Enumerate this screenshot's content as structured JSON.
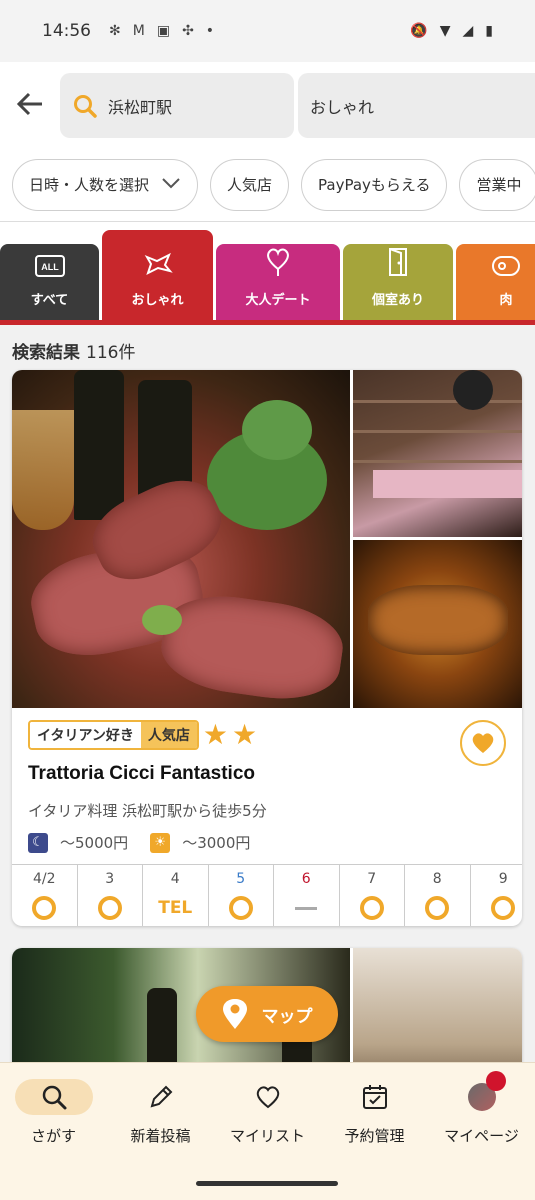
{
  "status_bar": {
    "time": "14:56",
    "dot": "•"
  },
  "search": {
    "area": "浜松町駅",
    "keyword": "おしゃれ"
  },
  "filters": [
    {
      "label": "日時・人数を選択",
      "has_chevron": true
    },
    {
      "label": "人気店"
    },
    {
      "label": "PayPayもらえる"
    },
    {
      "label": "営業中"
    }
  ],
  "tabs": [
    {
      "label": "すべて",
      "icon": "all-icon",
      "color": "#3a3a3a"
    },
    {
      "label": "おしゃれ",
      "icon": "ribbon-icon",
      "color": "#c8272c",
      "active": true
    },
    {
      "label": "大人デート",
      "icon": "heart-balloon-icon",
      "color": "#c72c7f"
    },
    {
      "label": "個室あり",
      "icon": "door-icon",
      "color": "#a5a43b"
    },
    {
      "label": "肉",
      "icon": "meat-icon",
      "color": "#e9782a"
    }
  ],
  "results": {
    "label": "検索結果",
    "count": "116件"
  },
  "card": {
    "badges": [
      "イタリアン好き",
      "人気店"
    ],
    "stars": 2,
    "name": "Trattoria Cicci Fantastico",
    "subtitle": "イタリア料理 浜松町駅から徒歩5分",
    "dinner_price": "～5000円",
    "lunch_price": "～3000円",
    "calendar": [
      {
        "date": "4/2",
        "status": "circle",
        "color": "#555"
      },
      {
        "date": "3",
        "status": "circle",
        "color": "#555"
      },
      {
        "date": "4",
        "status": "TEL",
        "color": "#555"
      },
      {
        "date": "5",
        "status": "circle",
        "color": "#3a7bc8"
      },
      {
        "date": "6",
        "status": "dash",
        "color": "#c0142c"
      },
      {
        "date": "7",
        "status": "circle",
        "color": "#555"
      },
      {
        "date": "8",
        "status": "circle",
        "color": "#555"
      },
      {
        "date": "9",
        "status": "circle",
        "color": "#555"
      }
    ]
  },
  "map_button": {
    "label": "マップ"
  },
  "bottom_nav": [
    {
      "label": "さがす",
      "icon": "search-icon",
      "active": true
    },
    {
      "label": "新着投稿",
      "icon": "pencil-icon"
    },
    {
      "label": "マイリスト",
      "icon": "heart-icon"
    },
    {
      "label": "予約管理",
      "icon": "calendar-check-icon"
    },
    {
      "label": "マイページ",
      "icon": "avatar-icon"
    }
  ],
  "colors": {
    "accent": "#f0a82a",
    "brand_red": "#c8272c",
    "nav_bg": "#fdf5e6"
  }
}
